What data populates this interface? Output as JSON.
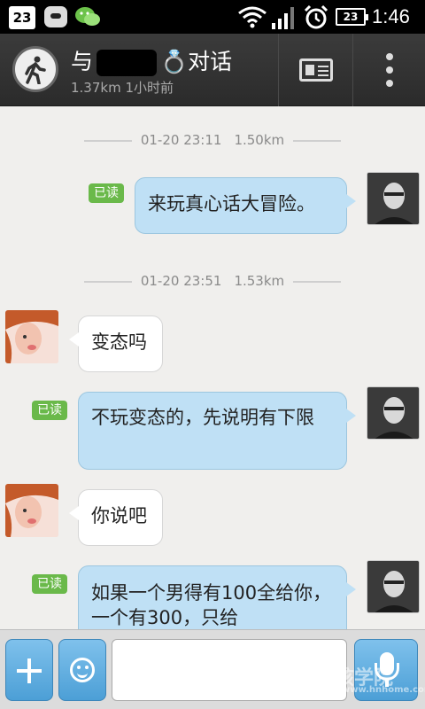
{
  "status_bar": {
    "calendar_day": "23",
    "battery_level": "23",
    "time": "1:46",
    "icons": [
      "calendar-icon",
      "talk-icon",
      "wechat-icon",
      "wifi-icon",
      "signal-icon",
      "alarm-icon",
      "battery-icon"
    ]
  },
  "header": {
    "title_prefix": "与",
    "title_suffix": "💍对话",
    "subtitle": "1.37km 1小时前",
    "back_icon": "walking-person-icon",
    "profile_icon": "profile-card-icon",
    "more_icon": "more-vertical-icon"
  },
  "messages": [
    {
      "kind": "time",
      "date": "01-20 23:11",
      "distance": "1.50km"
    },
    {
      "kind": "out",
      "read": "已读",
      "text": "来玩真心话大冒险。"
    },
    {
      "kind": "time",
      "date": "01-20 23:51",
      "distance": "1.53km"
    },
    {
      "kind": "in",
      "text": "变态吗"
    },
    {
      "kind": "out",
      "read": "已读",
      "text": "不玩变态的，先说明有下限"
    },
    {
      "kind": "in",
      "text": "你说吧"
    },
    {
      "kind": "out",
      "read": "已读",
      "text": "如果一个男得有100全给你，一个有300，只给"
    }
  ],
  "input_bar": {
    "plus_icon": "plus-icon",
    "emoji_icon": "smiley-icon",
    "message_value": "",
    "mic_icon": "microphone-icon",
    "watermark_main": "坏男孩学院",
    "watermark_sub": "www.hnhome.com"
  },
  "colors": {
    "outgoing_bubble": "#bfe0f5",
    "incoming_bubble": "#ffffff",
    "read_badge": "#6ab94a",
    "accent_button": "#4c9fd6"
  }
}
